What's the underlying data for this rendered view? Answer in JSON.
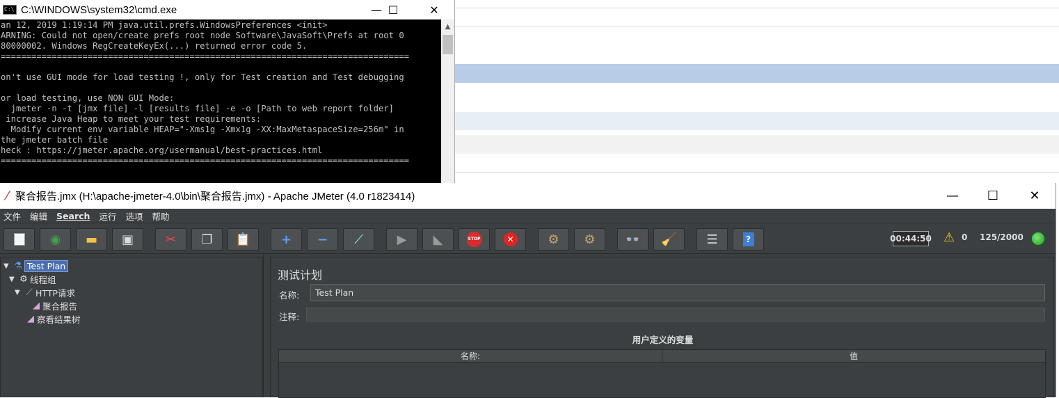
{
  "cmd": {
    "title": "C:\\WINDOWS\\system32\\cmd.exe",
    "icon_label": "C:\\",
    "minimize": "—",
    "maximize": "☐",
    "close": "✕",
    "lines": "an 12, 2019 1:19:14 PM java.util.prefs.WindowsPreferences <init>\nARNING: Could not open/create prefs root node Software\\JavaSoft\\Prefs at root 0\n80000002. Windows RegCreateKeyEx(...) returned error code 5.\n================================================================================\n\non't use GUI mode for load testing !, only for Test creation and Test debugging\n\nor load testing, use NON GUI Mode:\n  jmeter -n -t [jmx file] -l [results file] -e -o [Path to web report folder]\n increase Java Heap to meet your test requirements:\n  Modify current env variable HEAP=\"-Xms1g -Xmx1g -XX:MaxMetaspaceSize=256m\" in\nthe jmeter batch file\nheck : https://jmeter.apache.org/usermanual/best-practices.html\n================================================================================"
  },
  "jmeter": {
    "title": "聚合报告.jmx (H:\\apache-jmeter-4.0\\bin\\聚合报告.jmx) - Apache JMeter (4.0 r1823414)",
    "minimize": "—",
    "maximize": "☐",
    "close": "✕",
    "menu": [
      "文件",
      "编辑",
      "Search",
      "运行",
      "选项",
      "帮助"
    ],
    "toolbar": {
      "timer": "00:44:50",
      "warn_count": "0",
      "threads": "125/2000"
    },
    "tree": {
      "test_plan": "Test Plan",
      "thread_group": "线程组",
      "http_request": "HTTP请求",
      "aggregate_report": "聚合报告",
      "view_results_tree": "察看结果树"
    },
    "panel": {
      "title": "测试计划",
      "name_label": "名称:",
      "name_value": "Test Plan",
      "comment_label": "注释:",
      "vars_title": "用户定义的变量",
      "col_name": "名称:",
      "col_value": "值"
    }
  },
  "colors": {
    "jmeter_bg": "#3c3f41",
    "selection": "#4b6eaf",
    "status_green": "#1e9a1e"
  }
}
